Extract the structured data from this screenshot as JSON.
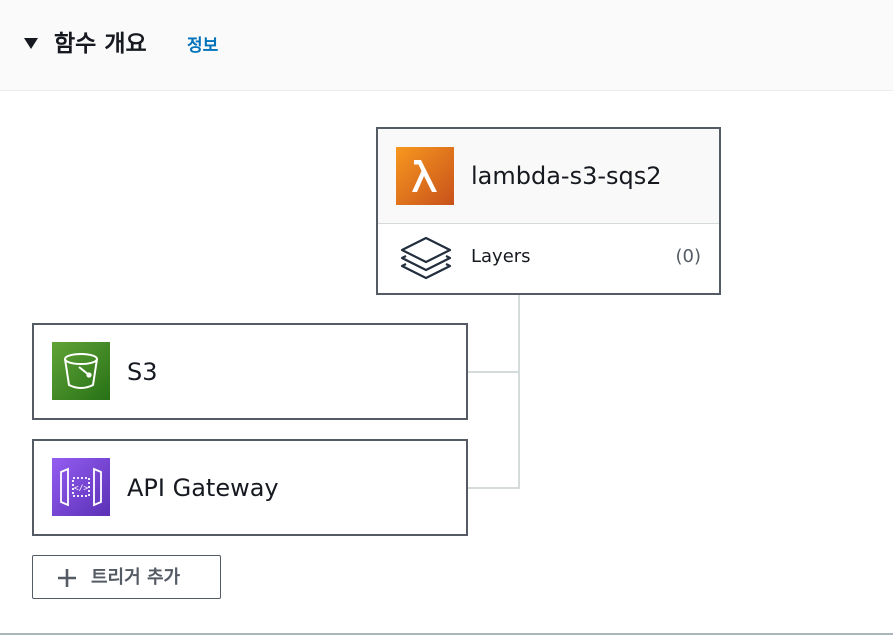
{
  "header": {
    "title": "함수 개요",
    "info_link": "정보",
    "collapse_icon": "caret-down-icon"
  },
  "function": {
    "name": "lambda-s3-sqs2",
    "icon": "lambda-icon",
    "icon_color": "#e8780f",
    "layers": {
      "label": "Layers",
      "count": "(0)",
      "icon": "layers-icon"
    }
  },
  "triggers": [
    {
      "label": "S3",
      "icon": "s3-bucket-icon",
      "color": "#3f8624"
    },
    {
      "label": "API Gateway",
      "icon": "api-gateway-icon",
      "color": "#7b45d8"
    }
  ],
  "add_trigger": {
    "label": "트리거 추가",
    "icon": "plus-icon"
  }
}
